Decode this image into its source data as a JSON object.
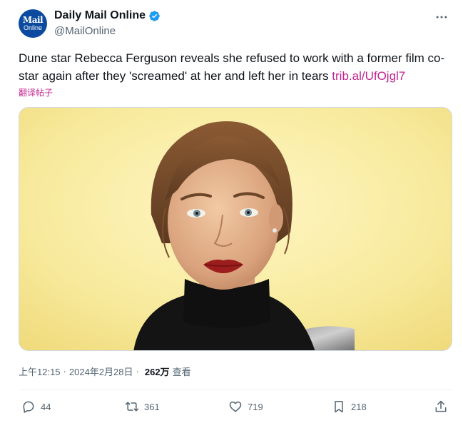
{
  "account": {
    "name": "Daily Mail Online",
    "handle": "@MailOnline",
    "avatar_line1": "Mail",
    "avatar_line2": "Online",
    "verified": true
  },
  "tweet": {
    "text": "Dune star Rebecca Ferguson reveals she refused to work with a former film co-star again after they 'screamed' at her and left her in tears ",
    "link": "trib.al/UfOjgl7",
    "translate_label": "翻译帖子"
  },
  "meta": {
    "time": "上午12:15",
    "separator": "·",
    "date": "2024年2月28日",
    "views_count": "262万",
    "views_label": "查看"
  },
  "actions": {
    "replies": "44",
    "retweets": "361",
    "likes": "719",
    "bookmarks": "218"
  },
  "colors": {
    "link": "#c3248e",
    "secondary_text": "#536471",
    "verified": "#1d9bf0",
    "avatar_bg": "#0b4a9e"
  },
  "icons": {
    "verified": "verified-badge-icon",
    "more": "more-options-icon",
    "reply": "reply-icon",
    "retweet": "retweet-icon",
    "like": "heart-icon",
    "bookmark": "bookmark-icon",
    "share": "share-icon"
  }
}
